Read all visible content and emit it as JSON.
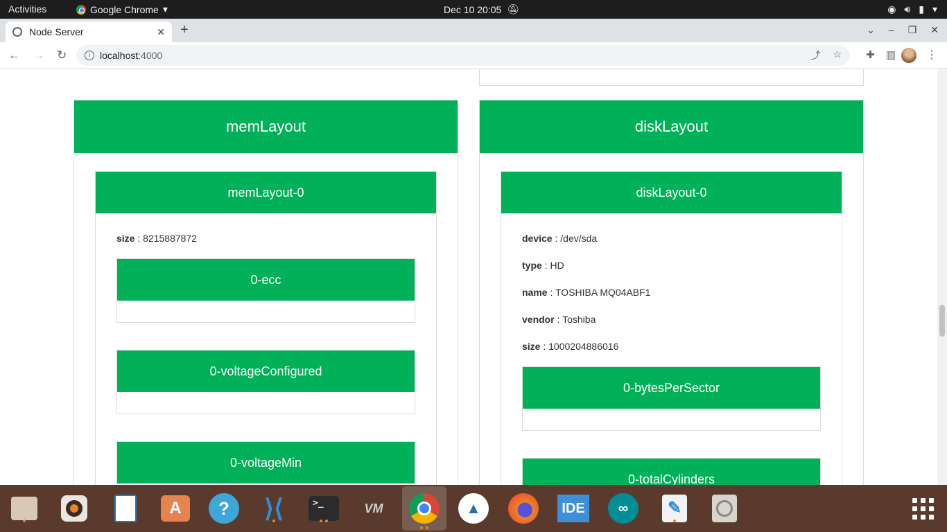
{
  "topbar": {
    "activities": "Activities",
    "app_name": "Google Chrome",
    "clock": "Dec 10  20:05"
  },
  "browser": {
    "tab_title": "Node Server",
    "url_host": "localhost",
    "url_port": ":4000"
  },
  "page": {
    "left": {
      "title": "memLayout",
      "inner": {
        "title": "memLayout-0",
        "fields": [
          {
            "key": "size",
            "value": "8215887872"
          }
        ],
        "subcards": [
          "0-ecc",
          "0-voltageConfigured",
          "0-voltageMin"
        ]
      }
    },
    "right": {
      "title": "diskLayout",
      "inner": {
        "title": "diskLayout-0",
        "fields": [
          {
            "key": "device",
            "value": "/dev/sda"
          },
          {
            "key": "type",
            "value": "HD"
          },
          {
            "key": "name",
            "value": "TOSHIBA MQ04ABF1"
          },
          {
            "key": "vendor",
            "value": "Toshiba"
          },
          {
            "key": "size",
            "value": "1000204886016"
          }
        ],
        "subcards": [
          "0-bytesPerSector",
          "0-totalCylinders"
        ]
      }
    }
  },
  "colors": {
    "header_green": "#00b159",
    "dock_bg": "#5a3a2c",
    "topbar_bg": "#1d1d1d"
  },
  "dock": {
    "items": [
      "files-icon",
      "rhythmbox-icon",
      "libreoffice-writer-icon",
      "app-center-icon",
      "help-icon",
      "vscode-icon",
      "terminal-icon",
      "vm-icon",
      "chrome-icon",
      "android-studio-icon",
      "firefox-icon",
      "ide-icon",
      "arduino-icon",
      "text-editor-icon",
      "disks-icon"
    ],
    "ide_label": "IDE"
  }
}
